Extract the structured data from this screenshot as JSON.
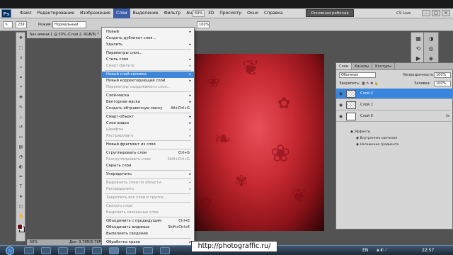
{
  "menubar": {
    "logo": "Ps",
    "items": [
      "Файл",
      "Редактирование",
      "Изображение",
      "Слои",
      "Выделение",
      "Фильтр",
      "Анализ",
      "3D",
      "Просмотр",
      "Окно",
      "Справка"
    ],
    "active_index": 3,
    "zoom": "50%",
    "workspace_button": "Основная рабочая среда",
    "cslive": "CS Live"
  },
  "optbar": {
    "size": "239",
    "mode_label": "Режим:",
    "mode_value": "Нормальный",
    "opacity_value": "100%"
  },
  "document": {
    "tab_title": "Без имени-1 @ 50% (Слой 2, RGB/8) *",
    "status_zoom": "50%",
    "status_doc": "Док: 3,76M/5,78M"
  },
  "dropdown": {
    "items": [
      {
        "label": "Новый",
        "arrow": true
      },
      {
        "label": "Создать дубликат слоя..."
      },
      {
        "label": "Удалить",
        "arrow": true
      },
      {
        "sep": true
      },
      {
        "label": "Параметры слоя..."
      },
      {
        "label": "Стиль слоя",
        "arrow": true
      },
      {
        "label": "Смарт-фильтр",
        "disabled": true,
        "arrow": true
      },
      {
        "sep": true
      },
      {
        "label": "Новый слой-заливка",
        "arrow": true,
        "highlight": true
      },
      {
        "label": "Новый корректирующий слой",
        "arrow": true
      },
      {
        "label": "Параметры содержимого слоя...",
        "disabled": true
      },
      {
        "sep": true
      },
      {
        "label": "Слой-маска",
        "arrow": true
      },
      {
        "label": "Векторная маска",
        "arrow": true
      },
      {
        "label": "Создать обтравочную маску",
        "shortcut": "Alt+Ctrl+G"
      },
      {
        "sep": true
      },
      {
        "label": "Смарт-объект",
        "arrow": true
      },
      {
        "label": "Слои видео",
        "arrow": true
      },
      {
        "label": "Шрифты",
        "disabled": true,
        "arrow": true
      },
      {
        "label": "Растрировать",
        "disabled": true,
        "arrow": true
      },
      {
        "sep": true
      },
      {
        "label": "Новый фрагмент из слоя"
      },
      {
        "sep": true
      },
      {
        "label": "Сгруппировать слои",
        "shortcut": "Ctrl+G"
      },
      {
        "label": "Разгруппировать слои",
        "disabled": true,
        "shortcut": "Shift+Ctrl+G"
      },
      {
        "label": "Скрыть слои"
      },
      {
        "sep": true
      },
      {
        "label": "Упорядочить",
        "arrow": true
      },
      {
        "sep": true
      },
      {
        "label": "Выровнять слои по области",
        "disabled": true,
        "arrow": true
      },
      {
        "label": "Распределить",
        "disabled": true,
        "arrow": true
      },
      {
        "sep": true
      },
      {
        "label": "Закрепить все слои в группе...",
        "disabled": true
      },
      {
        "sep": true
      },
      {
        "label": "Связать слои",
        "disabled": true
      },
      {
        "label": "Выделить связанные слои",
        "disabled": true
      },
      {
        "sep": true
      },
      {
        "label": "Объединить с предыдущим",
        "shortcut": "Ctrl+E"
      },
      {
        "label": "Объединить видимые",
        "shortcut": "Shift+Ctrl+E"
      },
      {
        "label": "Выполнить сведение"
      },
      {
        "sep": true
      },
      {
        "label": "Обработка краев",
        "arrow": true
      }
    ]
  },
  "layers_panel": {
    "tabs": [
      "Слои",
      "Каналы",
      "Контуры"
    ],
    "blend_mode": "Обычные",
    "opacity_label": "Непрозрачность:",
    "opacity_value": "100%",
    "lock_label": "Закрепить:",
    "fill_label": "Заливка:",
    "fill_value": "100%",
    "layers": [
      {
        "name": "Слой 2",
        "selected": true,
        "thumb": "transparent"
      },
      {
        "name": "Слой 1",
        "selected": false,
        "thumb": "transparent"
      },
      {
        "name": "Слой 0",
        "selected": false,
        "thumb": "white",
        "fx": "fx"
      }
    ],
    "effects_label": "Эффекты",
    "effects": [
      "Внутреннее свечение",
      "Наложение градиента"
    ]
  },
  "taskbar": {
    "url": "http://photograffic.ru/",
    "lang": "EN",
    "time": "22:57"
  },
  "colors": {
    "canvas_center": "#e8505a",
    "canvas_edge": "#2a0406",
    "foreground_swatch": "#6a1212",
    "selection": "#3a86dd"
  }
}
